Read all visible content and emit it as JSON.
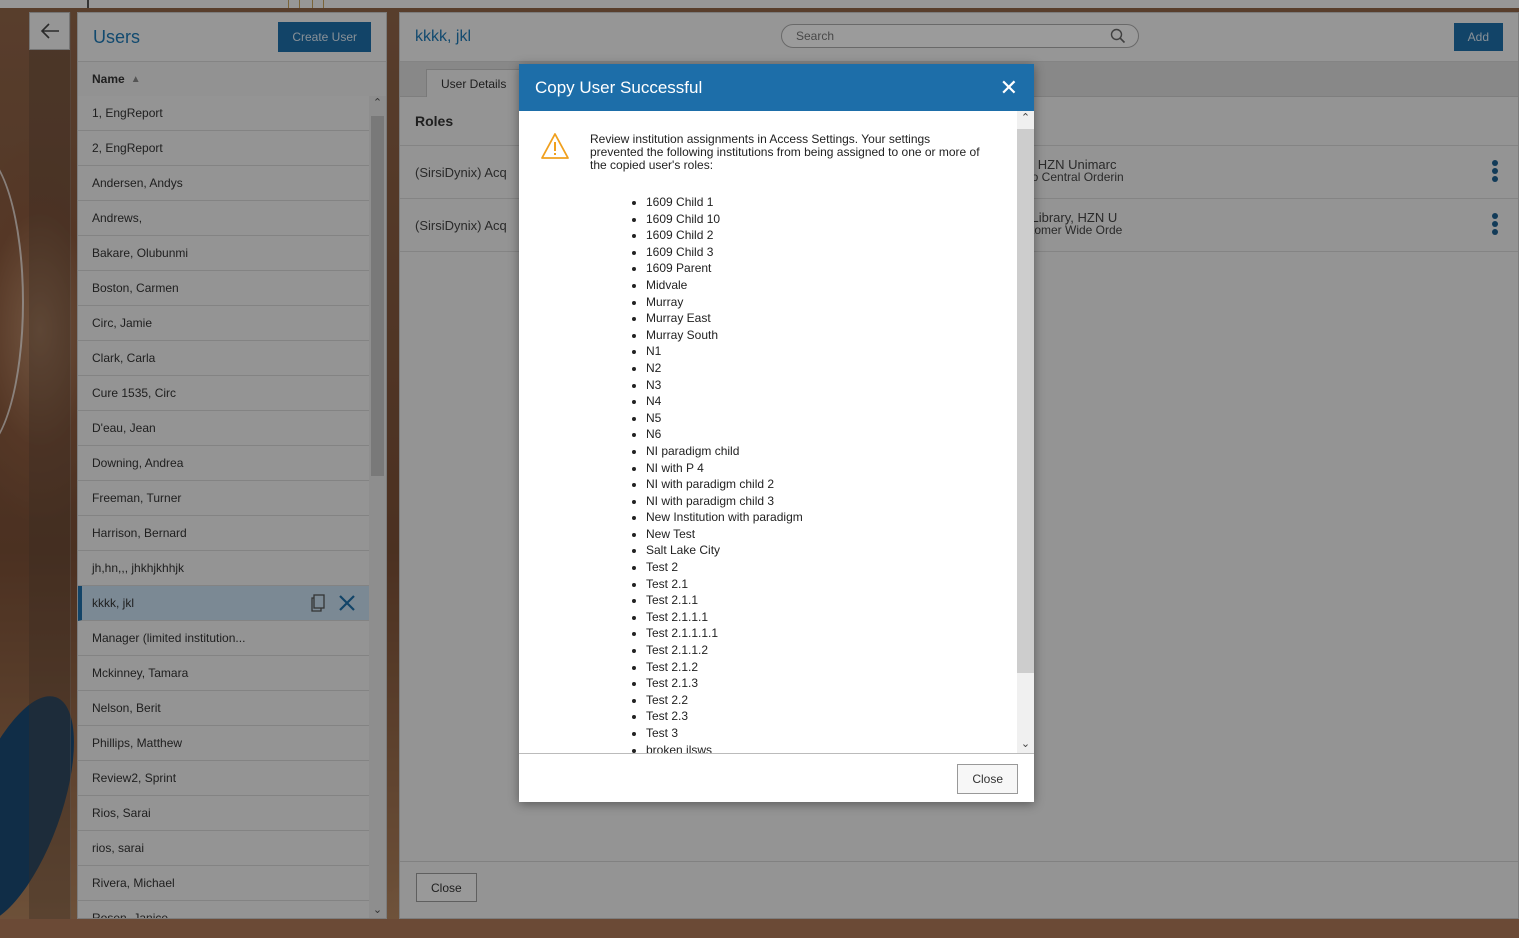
{
  "users_panel": {
    "title": "Users",
    "create_button": "Create User",
    "column_header": "Name",
    "users": [
      "1, EngReport",
      "2, EngReport",
      "Andersen, Andys",
      "Andrews,",
      "Bakare, Olubunmi",
      "Boston, Carmen",
      "Circ, Jamie",
      "Clark, Carla",
      "Cure 1535, Circ",
      "D'eau, Jean",
      "Downing, Andrea",
      "Freeman, Turner",
      "Harrison, Bernard",
      "jh,hn,,, jhkhjkhhjk",
      "kkkk, jkl",
      "Manager (limited institution...",
      "Mckinney, Tamara",
      "Nelson, Berit",
      "Phillips, Matthew",
      "Review2, Sprint",
      "Rios, Sarai",
      "rios, sarai",
      "Rivera, Michael",
      "Rosen, Janice"
    ],
    "selected_user": "kkkk, jkl"
  },
  "detail": {
    "title": "kkkk, jkl",
    "search_placeholder": "Search",
    "add_button": "Add",
    "tab_label": "User Details",
    "roles_heading": "Roles",
    "roles": [
      {
        "name": "(SirsiDynix) Acq",
        "line1": "y, HZN Unimarc",
        "line2": "no Central Orderin"
      },
      {
        "name": "(SirsiDynix) Acq",
        "line1": "l Library, HZN U",
        "line2": "stomer Wide Orde"
      }
    ],
    "close_button": "Close"
  },
  "modal": {
    "title": "Copy User Successful",
    "message": "Review institution assignments in Access Settings. Your settings prevented the following institutions from being assigned to one or more of the copied user's roles:",
    "institutions": [
      "1609 Child 1",
      "1609 Child 10",
      "1609 Child 2",
      "1609 Child 3",
      "1609 Parent",
      "Midvale",
      "Murray",
      "Murray East",
      "Murray South",
      "N1",
      "N2",
      "N3",
      "N4",
      "N5",
      "N6",
      "NI paradigm child",
      "NI with P 4",
      "NI with paradigm child 2",
      "NI with paradigm child 3",
      "New Institution with paradigm",
      "New Test",
      "Salt Lake City",
      "Test 2",
      "Test 2.1",
      "Test 2.1.1",
      "Test 2.1.1.1",
      "Test 2.1.1.1.1",
      "Test 2.1.1.2",
      "Test 2.1.2",
      "Test 2.1.3",
      "Test 2.2",
      "Test 2.3",
      "Test 3",
      "broken ilsws"
    ],
    "close_button": "Close"
  },
  "colors": {
    "accent": "#1d6ea9",
    "title_blue": "#1e78b4",
    "warning": "#f0a01e"
  },
  "icons": {
    "back": "arrow-left-icon",
    "search": "search-icon",
    "copy": "copy-icon",
    "delete": "close-icon",
    "more": "kebab-icon",
    "warning": "warning-icon",
    "modal_close": "close-icon"
  }
}
